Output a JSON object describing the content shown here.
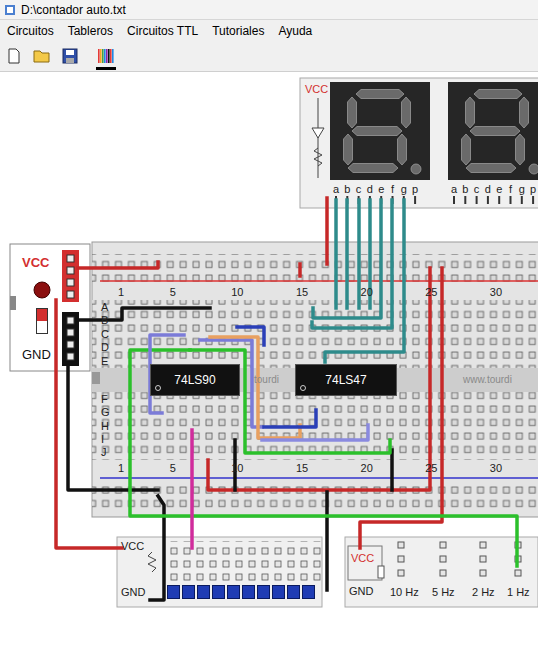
{
  "window": {
    "title": "D:\\contador auto.txt"
  },
  "menu": [
    {
      "label": "Circuitos"
    },
    {
      "label": "Tableros"
    },
    {
      "label": "Circuitos TTL"
    },
    {
      "label": "Tutoriales"
    },
    {
      "label": "Ayuda"
    }
  ],
  "toolbar": [
    {
      "kind": "new",
      "selected": false
    },
    {
      "kind": "open",
      "selected": false
    },
    {
      "kind": "save",
      "selected": false
    },
    {
      "kind": "colors",
      "selected": true
    }
  ],
  "display": {
    "vcc": "VCC",
    "digits": [
      {
        "lit": false,
        "pins": [
          "a",
          "b",
          "c",
          "d",
          "e",
          "f",
          "g",
          "p"
        ]
      },
      {
        "lit": false,
        "pins": [
          "a",
          "b",
          "c",
          "d",
          "e",
          "f",
          "g",
          "p"
        ]
      }
    ]
  },
  "breadboard": {
    "top_numbers": [
      "1",
      "5",
      "10",
      "15",
      "20",
      "25",
      "30"
    ],
    "bottom_numbers": [
      "1",
      "5",
      "10",
      "15",
      "20",
      "25",
      "30"
    ],
    "rows_top": [
      "A",
      "B",
      "C",
      "D",
      "E"
    ],
    "rows_bottom": [
      "F",
      "G",
      "H",
      "I",
      "J"
    ],
    "chips": [
      {
        "label": "74LS90"
      },
      {
        "label": "74LS47"
      }
    ],
    "watermark": [
      "tourdi",
      "www.tourdi"
    ]
  },
  "power_supply": {
    "vcc": "VCC",
    "gnd": "GND",
    "switch_on": true,
    "led_lit": false
  },
  "led_board": {
    "vcc": "VCC",
    "gnd": "GND",
    "leds": [
      {
        "lit": false
      },
      {
        "lit": false
      },
      {
        "lit": false
      },
      {
        "lit": false
      },
      {
        "lit": false
      },
      {
        "lit": false
      },
      {
        "lit": false
      },
      {
        "lit": false
      },
      {
        "lit": false
      },
      {
        "lit": false
      }
    ]
  },
  "clock": {
    "vcc": "VCC",
    "gnd": "GND",
    "frequencies": [
      "10 Hz",
      "5 Hz",
      "2 Hz",
      "1 Hz"
    ]
  }
}
